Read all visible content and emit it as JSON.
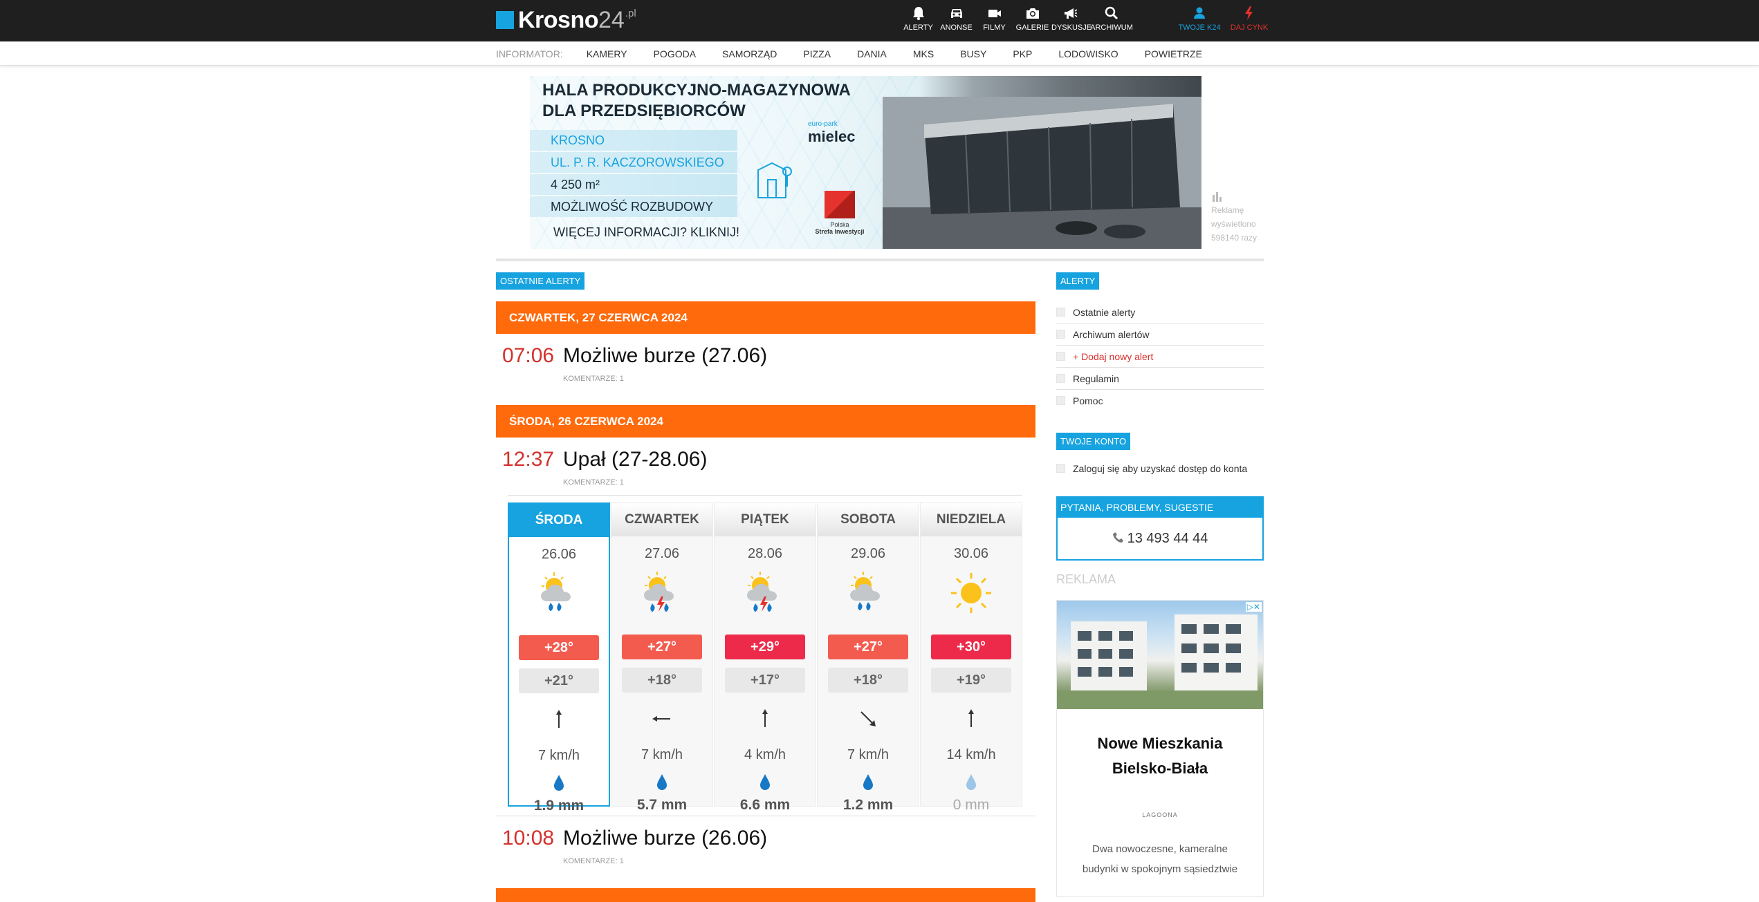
{
  "header": {
    "logo_text": "Krosno",
    "logo_num": "24",
    "logo_suffix": ".pl",
    "nav": [
      {
        "label": "ALERTY",
        "icon": "bell-icon"
      },
      {
        "label": "ANONSE",
        "icon": "car-icon"
      },
      {
        "label": "FILMY",
        "icon": "video-camera-icon"
      },
      {
        "label": "GALERIE",
        "icon": "photo-camera-icon"
      },
      {
        "label": "DYSKUSJE",
        "icon": "megaphone-icon"
      },
      {
        "label": "ARCHIWUM",
        "icon": "search-icon"
      }
    ],
    "account": {
      "label": "TWOJE K24",
      "icon": "user-icon"
    },
    "tip": {
      "label": "DAJ CYNK",
      "icon": "lightning-icon"
    }
  },
  "subnav": {
    "label": "INFORMATOR:",
    "items": [
      "KAMERY",
      "POGODA",
      "SAMORZĄD",
      "PIZZA",
      "DANIA",
      "MKS",
      "BUSY",
      "PKP",
      "LODOWISKO",
      "POWIETRZE"
    ]
  },
  "banner": {
    "heading1": "HALA PRODUKCYJNO-MAGAZYNOWA",
    "heading2": "DLA PRZEDSIĘBIORCÓW",
    "lines": [
      "KROSNO",
      "UL. P. R. KACZOROWSKIEGO",
      "4 250 m²",
      "MOŻLIWOŚĆ ROZBUDOWY"
    ],
    "cta": "WIĘCEJ INFORMACJI? KLIKNIJ!",
    "brand_small": "euro-park",
    "brand_big": "mielec",
    "strefa1": "Polska",
    "strefa2": "Strefa Inwestycji"
  },
  "ad_stats": {
    "line1": "Reklamę",
    "line2": "wyświetlono",
    "line3": "598140 razy"
  },
  "main": {
    "section_tag": "OSTATNIE ALERTY",
    "days": [
      {
        "header": "CZWARTEK, 27 CZERWCA 2024"
      },
      {
        "header": "ŚRODA, 26 CZERWCA 2024"
      }
    ],
    "alerts": [
      {
        "time": "07:06",
        "title": "Możliwe burze (27.06)",
        "comments": "KOMENTARZE: 1"
      },
      {
        "time": "12:37",
        "title": "Upał (27-28.06)",
        "comments": "KOMENTARZE: 1"
      },
      {
        "time": "10:08",
        "title": "Możliwe burze (26.06)",
        "comments": "KOMENTARZE: 1"
      }
    ],
    "forecast": [
      {
        "day": "ŚRODA",
        "date": "26.06",
        "icon": "cloud-sun-rain-icon",
        "tmax": "+28°",
        "tmin": "+21°",
        "wind_dir": "north",
        "wind": "7 km/h",
        "rain": "1.9 mm",
        "max_color": "#f45b4f"
      },
      {
        "day": "CZWARTEK",
        "date": "27.06",
        "icon": "cloud-sun-storm-icon",
        "tmax": "+27°",
        "tmin": "+18°",
        "wind_dir": "west",
        "wind": "7 km/h",
        "rain": "5.7 mm",
        "max_color": "#f45b4f"
      },
      {
        "day": "PIĄTEK",
        "date": "28.06",
        "icon": "cloud-sun-storm-icon",
        "tmax": "+29°",
        "tmin": "+17°",
        "wind_dir": "north",
        "wind": "4 km/h",
        "rain": "6.6 mm",
        "max_color": "#ee2a4a"
      },
      {
        "day": "SOBOTA",
        "date": "29.06",
        "icon": "cloud-sun-rain-icon",
        "tmax": "+27°",
        "tmin": "+18°",
        "wind_dir": "south-east",
        "wind": "7 km/h",
        "rain": "1.2 mm",
        "max_color": "#f45b4f"
      },
      {
        "day": "NIEDZIELA",
        "date": "30.06",
        "icon": "sun-icon",
        "tmax": "+30°",
        "tmin": "+19°",
        "wind_dir": "north",
        "wind": "14 km/h",
        "rain": "0 mm",
        "max_color": "#ee2a4a"
      }
    ]
  },
  "sidebar": {
    "alerts_tag": "ALERTY",
    "alert_links": [
      "Ostatnie alerty",
      "Archiwum alertów",
      "+ Dodaj nowy alert",
      "Regulamin",
      "Pomoc"
    ],
    "account_tag": "TWOJE KONTO",
    "account_link": "Zaloguj się aby uzyskać dostęp do konta",
    "questions_header": "PYTANIA, PROBLEMY, SUGESTIE",
    "phone": "13 493 44 44",
    "ad_label": "REKLAMA",
    "ad_title_1": "Nowe Mieszkania",
    "ad_title_2": "Bielsko-Biała",
    "ad_logo": "LAGOONA",
    "ad_desc_1": "Dwa nowoczesne, kameralne",
    "ad_desc_2": "budynki w spokojnym sąsiedztwie",
    "adchoices": "▷✕"
  }
}
